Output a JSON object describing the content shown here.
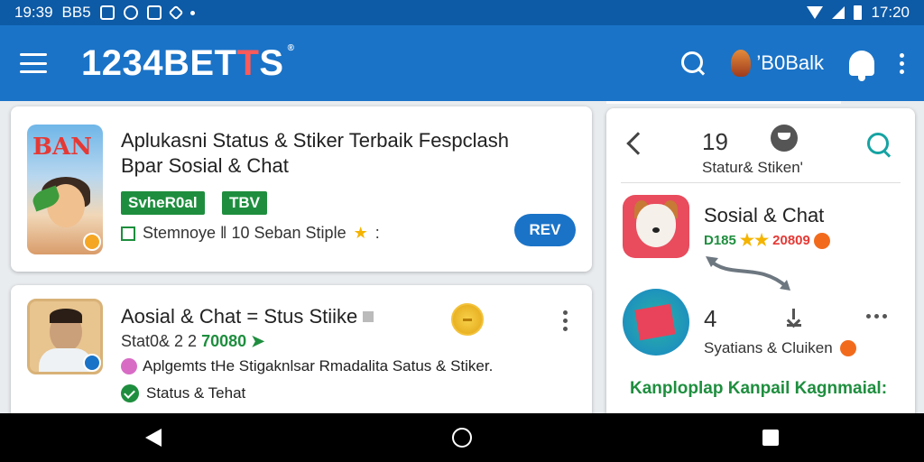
{
  "status_bar": {
    "time_left": "19:39",
    "carrier": "BB5",
    "time_right": "17:20"
  },
  "app_bar": {
    "brand_main": "1234BET",
    "brand_accent": "T",
    "brand_tail": "S",
    "brand_mark": "®",
    "user_label": "’B0Balk"
  },
  "card1": {
    "icon_text": "BAN",
    "title_line1": "Aplukasni Status & Stiker Terbaik Fespclash",
    "title_line2": "Bpar Sosial & Chat",
    "tag1": "SvheR0al",
    "tag2": "TBV",
    "meta": "Stemnoye  ‖  10 Seban Stiple",
    "meta_star": "★",
    "meta_tail": ":",
    "button": "REV"
  },
  "card2": {
    "title": "Aosial & Chat = Stus Stiike",
    "sub_prefix": "Stat0& 2 2 ",
    "sub_number": "70080",
    "sub_arrow": "➤",
    "desc": "Aplgemts  tHe Stigaknlsar Rmadalita Satus & Stiker.",
    "foot": "Status & Tehat"
  },
  "panel": {
    "count": "19",
    "subtitle": "Statur& Stiken'",
    "item1": {
      "title": "Sosial & Chat",
      "rating_prefix": "D185",
      "stars": "★★",
      "rating_value": "20809"
    },
    "item2": {
      "number": "4",
      "subtitle": "Syatians & Cluiken"
    },
    "link": "Kanploplap Kanpail Kagnmaial:"
  },
  "colors": {
    "app_bar": "#1a73c7",
    "status_bar": "#0d5aa6",
    "accent_green": "#1e8e3e",
    "accent_red": "#ff5a5a",
    "star_gold": "#f5b400"
  },
  "icons": {
    "menu": "hamburger-icon",
    "search": "search-icon",
    "notifications": "bell-icon",
    "overflow": "kebab-icon",
    "back": "chevron-left-icon",
    "download": "download-icon",
    "nav_back": "triangle-back-icon",
    "nav_home": "circle-home-icon",
    "nav_recent": "square-recent-icon"
  }
}
